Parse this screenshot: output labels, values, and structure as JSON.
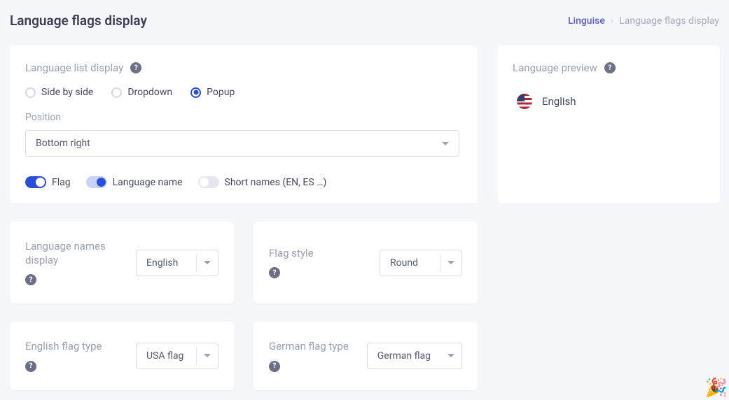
{
  "header": {
    "title": "Language flags display",
    "breadcrumb": {
      "root": "Linguise",
      "separator": "›",
      "current": "Language flags display"
    }
  },
  "main": {
    "list_display_label": "Language list display",
    "options": {
      "side_by_side": "Side by side",
      "dropdown": "Dropdown",
      "popup": "Popup",
      "selected": "popup"
    },
    "position_label": "Position",
    "position_value": "Bottom right",
    "toggles": {
      "flag": {
        "label": "Flag",
        "on": true
      },
      "language_name": {
        "label": "Language name",
        "on": true
      },
      "short_names": {
        "label": "Short names (EN, ES …)",
        "on": false
      }
    }
  },
  "preview": {
    "label": "Language preview",
    "lang": "English"
  },
  "settings": {
    "language_names_display": {
      "label": "Language names display",
      "value": "English"
    },
    "flag_style": {
      "label": "Flag style",
      "value": "Round"
    },
    "english_flag_type": {
      "label": "English flag type",
      "value": "USA flag"
    },
    "german_flag_type": {
      "label": "German flag type",
      "value": "German flag"
    }
  }
}
